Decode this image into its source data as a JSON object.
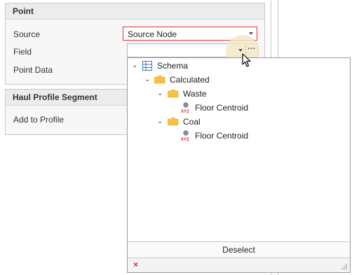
{
  "point_section": {
    "title": "Point",
    "source_label": "Source",
    "source_value": "Source Node",
    "field_label": "Field",
    "field_value": "",
    "field_more_label": "···",
    "point_data_label": "Point Data"
  },
  "haul_section": {
    "title": "Haul Profile Segment",
    "add_to_profile_label": "Add to Profile"
  },
  "tree": {
    "schema": "Schema",
    "calculated": "Calculated",
    "waste": "Waste",
    "waste_item": "Floor Centroid",
    "coal": "Coal",
    "coal_item": "Floor Centroid"
  },
  "popup": {
    "deselect_label": "Deselect",
    "close_glyph": "×"
  },
  "colors": {
    "highlight_border": "#e2323a",
    "folder": "#f5c242",
    "close": "#d62626"
  },
  "icons": [
    "chevron-down-icon",
    "table-icon",
    "folder-icon",
    "xyz-point-icon",
    "close-icon",
    "resize-grip-icon",
    "mouse-cursor-icon"
  ]
}
